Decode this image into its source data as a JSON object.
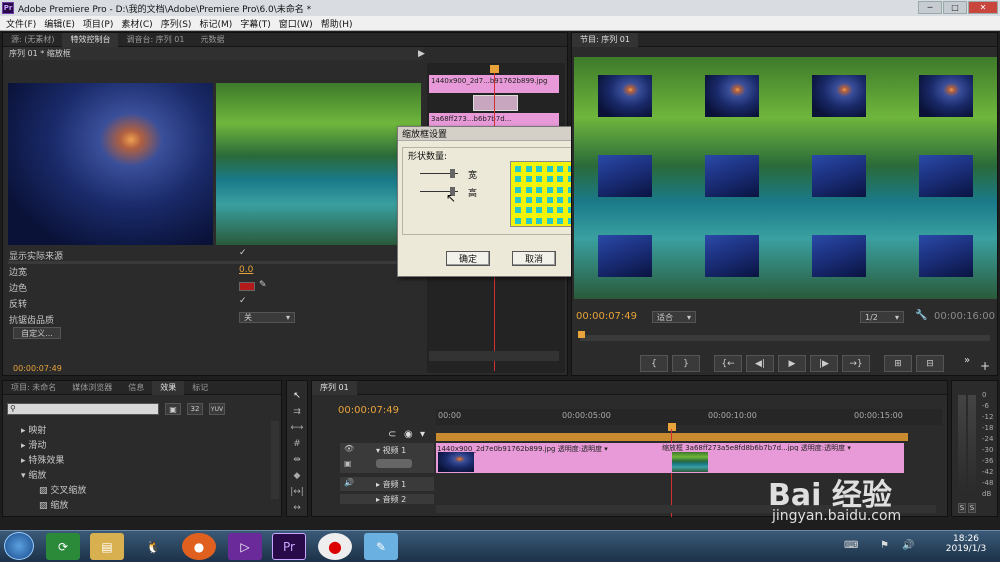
{
  "window": {
    "title": "Adobe Premiere Pro - D:\\我的文档\\Adobe\\Premiere Pro\\6.0\\未命名 *",
    "logo_text": "Pr"
  },
  "window_controls": {
    "minimize": "─",
    "maximize": "□",
    "close": "✕"
  },
  "menu": [
    "文件(F)",
    "编辑(E)",
    "项目(P)",
    "素材(C)",
    "序列(S)",
    "标记(M)",
    "字幕(T)",
    "窗口(W)",
    "帮助(H)"
  ],
  "top_left_tabs": [
    "源: (无素材)",
    "特效控制台",
    "调音台: 序列 01",
    "元数据"
  ],
  "effect_controls": {
    "sequence_label": "序列 01 * 缩放框",
    "timecode": "00:00:07:49",
    "mini_clip_label_1": "1440x900_2d7...b91762b899.jpg",
    "mini_clip_label_2": "3a68ff273...b6b7b7d...",
    "props": [
      {
        "label": "显示实际来源",
        "value": "✓"
      },
      {
        "label": "边宽",
        "value": "0.0"
      },
      {
        "label": "边色",
        "value": ""
      },
      {
        "label": "反转",
        "value": "✓"
      },
      {
        "label": "抗锯齿品质",
        "value": "关"
      }
    ],
    "custom_button": "自定义...",
    "border_color": "#b31b1b"
  },
  "dialog": {
    "title": "缩放框设置",
    "group_label": "形状数量:",
    "width_label": "宽",
    "height_label": "高",
    "ok": "确定",
    "cancel": "取消",
    "close": "✕",
    "grid_colors": {
      "background": "#f2f20a",
      "cell": "#26c9c9"
    }
  },
  "program_monitor": {
    "tab": "节目: 序列 01",
    "current_time": "00:00:07:49",
    "fit": "适合",
    "resolution": "1/2",
    "duration": "00:00:16:00"
  },
  "transport_buttons": [
    "{",
    "}",
    "{←",
    "◀|",
    "▶",
    "|▶",
    "→}",
    "⊞",
    "⊟"
  ],
  "project_tabs": [
    "项目: 未命名",
    "媒体浏览器",
    "信息",
    "效果",
    "标记"
  ],
  "effects_tree": [
    "映射",
    "滑动",
    "特殊效果",
    "缩放",
    "交叉缩放",
    "缩放"
  ],
  "timeline": {
    "tab": "序列 01",
    "current_time": "00:00:07:49",
    "ruler": [
      "00:00",
      "00:00:05:00",
      "00:00:10:00",
      "00:00:15:00"
    ],
    "video_track": "视频 1",
    "audio_track_1": "音频 1",
    "audio_track_2": "音频 2",
    "clip_label": "1440x900_2d7e0b91762b899.jpg  透明度:透明度 ▾",
    "clip_label_2": "缩放框  3a68ff273a5e8fd8b6b7b7d...jpg  透明度:透明度 ▾"
  },
  "audio_meter": {
    "scale": [
      "0",
      "-6",
      "-12",
      "-18",
      "-24",
      "-30",
      "-36",
      "-42",
      "-48",
      "dB"
    ],
    "solo": "S"
  },
  "taskbar": {
    "time": "18:26",
    "date": "2019/1/3"
  },
  "watermark": {
    "brand": "Bai 经验",
    "url": "jingyan.baidu.com"
  }
}
